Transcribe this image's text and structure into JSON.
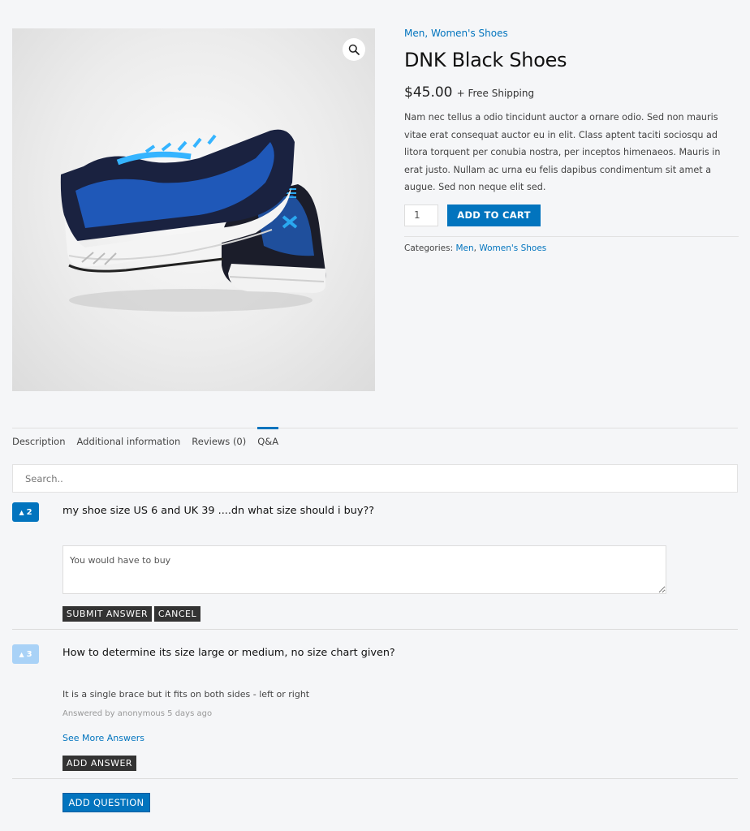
{
  "product": {
    "categories_top": [
      "Men",
      "Women's Shoes"
    ],
    "title": "DNK Black Shoes",
    "price": "$45.00",
    "shipping": "+ Free Shipping",
    "description": "Nam nec tellus a odio tincidunt auctor a ornare odio. Sed non mauris vitae erat consequat auctor eu in elit. Class aptent taciti sociosqu ad litora torquent per conubia nostra, per inceptos himenaeos. Mauris in erat justo. Nullam ac urna eu felis dapibus condimentum sit amet a augue. Sed non neque elit sed.",
    "quantity": "1",
    "add_to_cart": "ADD TO CART",
    "meta_label": "Categories:",
    "meta_categories": [
      "Men",
      "Women's Shoes"
    ],
    "zoom_icon": "magnifier-icon",
    "image_alt": "Blue and black running shoes"
  },
  "tabs": [
    {
      "label": "Description",
      "active": false
    },
    {
      "label": "Additional information",
      "active": false
    },
    {
      "label": "Reviews (0)",
      "active": false
    },
    {
      "label": "Q&A",
      "active": true
    }
  ],
  "qa": {
    "search_placeholder": "Search..",
    "questions": [
      {
        "votes": "2",
        "text": "my shoe size US 6 and UK 39 ....dn what size should i buy??",
        "answer_draft": "You would have to buy",
        "submit_label": "SUBMIT ANSWER",
        "cancel_label": "CANCEL"
      },
      {
        "votes": "3",
        "text": "How to determine its size large or medium, no size chart given?",
        "answer": "It is a single brace but it fits on both sides - left or right",
        "answered_by": "Answered by anonymous 5 days ago",
        "see_more": "See More Answers",
        "add_answer_label": "ADD ANSWER"
      }
    ],
    "add_question_label": "ADD QUESTION"
  },
  "colors": {
    "accent": "#0274be",
    "vote_active": "#0274be",
    "vote_light": "#a9d2f7",
    "dark_button": "#333333",
    "page_bg": "#f5f6f8"
  }
}
